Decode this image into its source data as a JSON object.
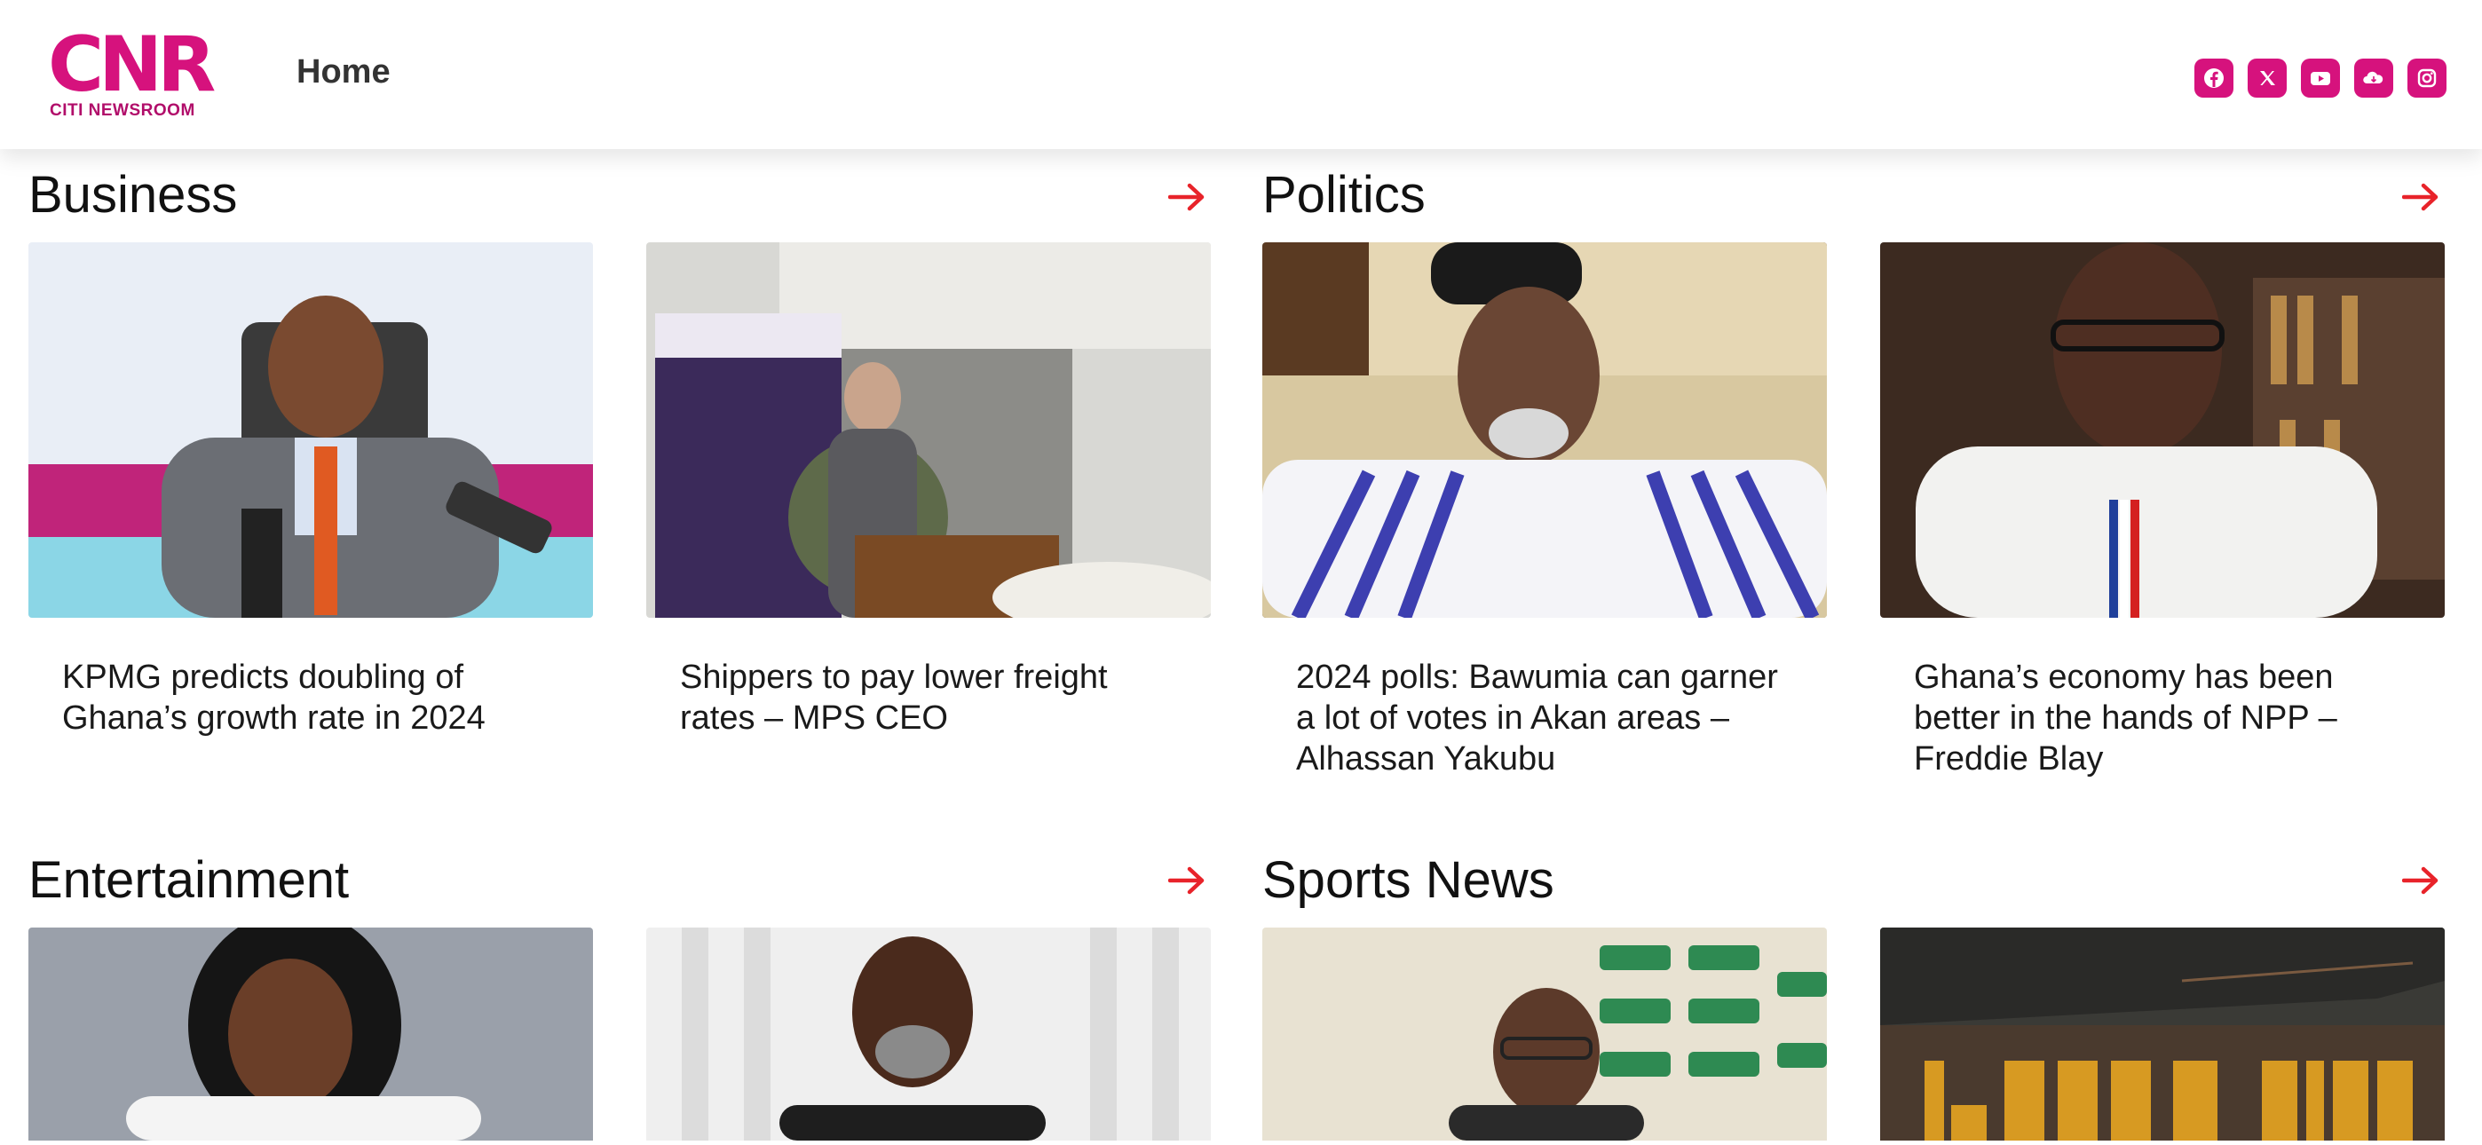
{
  "header": {
    "logo_text": "CNR",
    "logo_subtitle": "CITI NEWSROOM",
    "nav_home": "Home",
    "social_icons": [
      "facebook-icon",
      "x-icon",
      "youtube-icon",
      "soundcloud-icon",
      "instagram-icon"
    ],
    "accent_color": "#d6127d"
  },
  "sections": [
    {
      "title": "Business",
      "cards": [
        {
          "headline": "KPMG predicts doubling of Ghana’s growth rate in 2024"
        },
        {
          "headline": "Shippers to pay lower freight rates – MPS CEO"
        }
      ]
    },
    {
      "title": "Politics",
      "cards": [
        {
          "headline": "2024 polls: Bawumia can garner a lot of votes in Akan areas – Alhassan Yakubu"
        },
        {
          "headline": "Ghana’s economy has been better in the hands of NPP – Freddie Blay"
        }
      ]
    },
    {
      "title": "Entertainment",
      "cards": [
        {
          "headline": ""
        },
        {
          "headline": ""
        }
      ]
    },
    {
      "title": "Sports News",
      "cards": [
        {
          "headline": ""
        },
        {
          "headline": ""
        }
      ]
    }
  ],
  "arrow_color": "#e8232a"
}
